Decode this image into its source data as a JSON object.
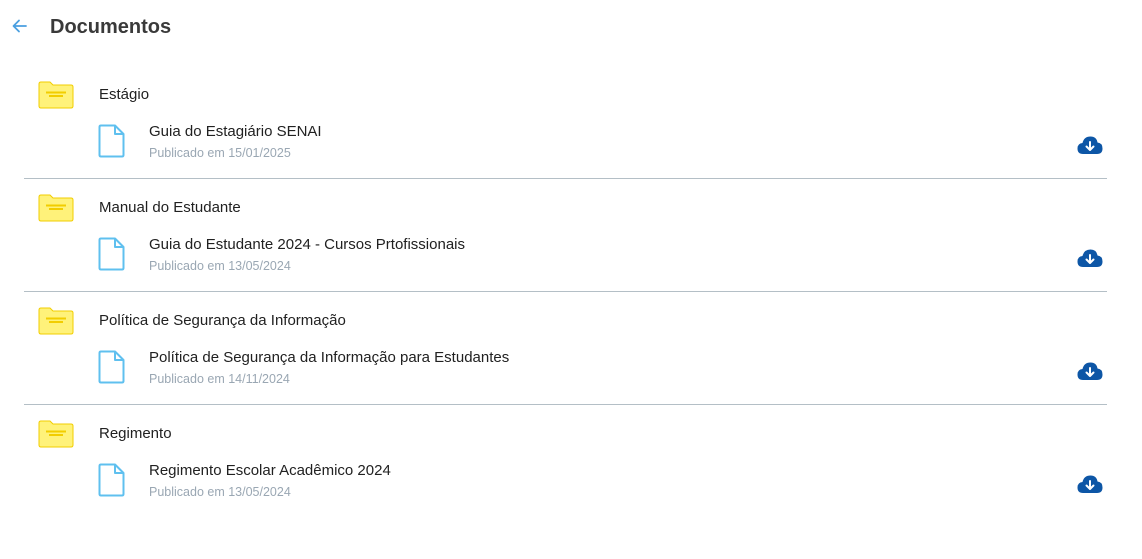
{
  "header": {
    "title": "Documentos"
  },
  "groups": [
    {
      "title": "Estágio",
      "document": {
        "title": "Guia do Estagiário SENAI",
        "date": "Publicado em 15/01/2025"
      }
    },
    {
      "title": "Manual do Estudante",
      "document": {
        "title": "Guia do Estudante 2024 - Cursos Prtofissionais",
        "date": "Publicado em 13/05/2024"
      }
    },
    {
      "title": "Política de Segurança da Informação",
      "document": {
        "title": "Política de Segurança da Informação para Estudantes",
        "date": "Publicado em 14/11/2024"
      }
    },
    {
      "title": "Regimento",
      "document": {
        "title": "Regimento Escolar Acadêmico 2024",
        "date": "Publicado em 13/05/2024"
      }
    }
  ],
  "icons": {
    "back": "arrow-left-icon",
    "folder": "folder-icon",
    "file": "file-icon",
    "download": "cloud-download-icon"
  },
  "colors": {
    "accent": "#4a9fe0",
    "folder": "#fff27a",
    "folder_stroke": "#f2cd00",
    "file_stroke": "#5fc0ef",
    "download": "#0d56a6",
    "divider": "#b4bfc6",
    "date_text": "#9aa7b3"
  }
}
